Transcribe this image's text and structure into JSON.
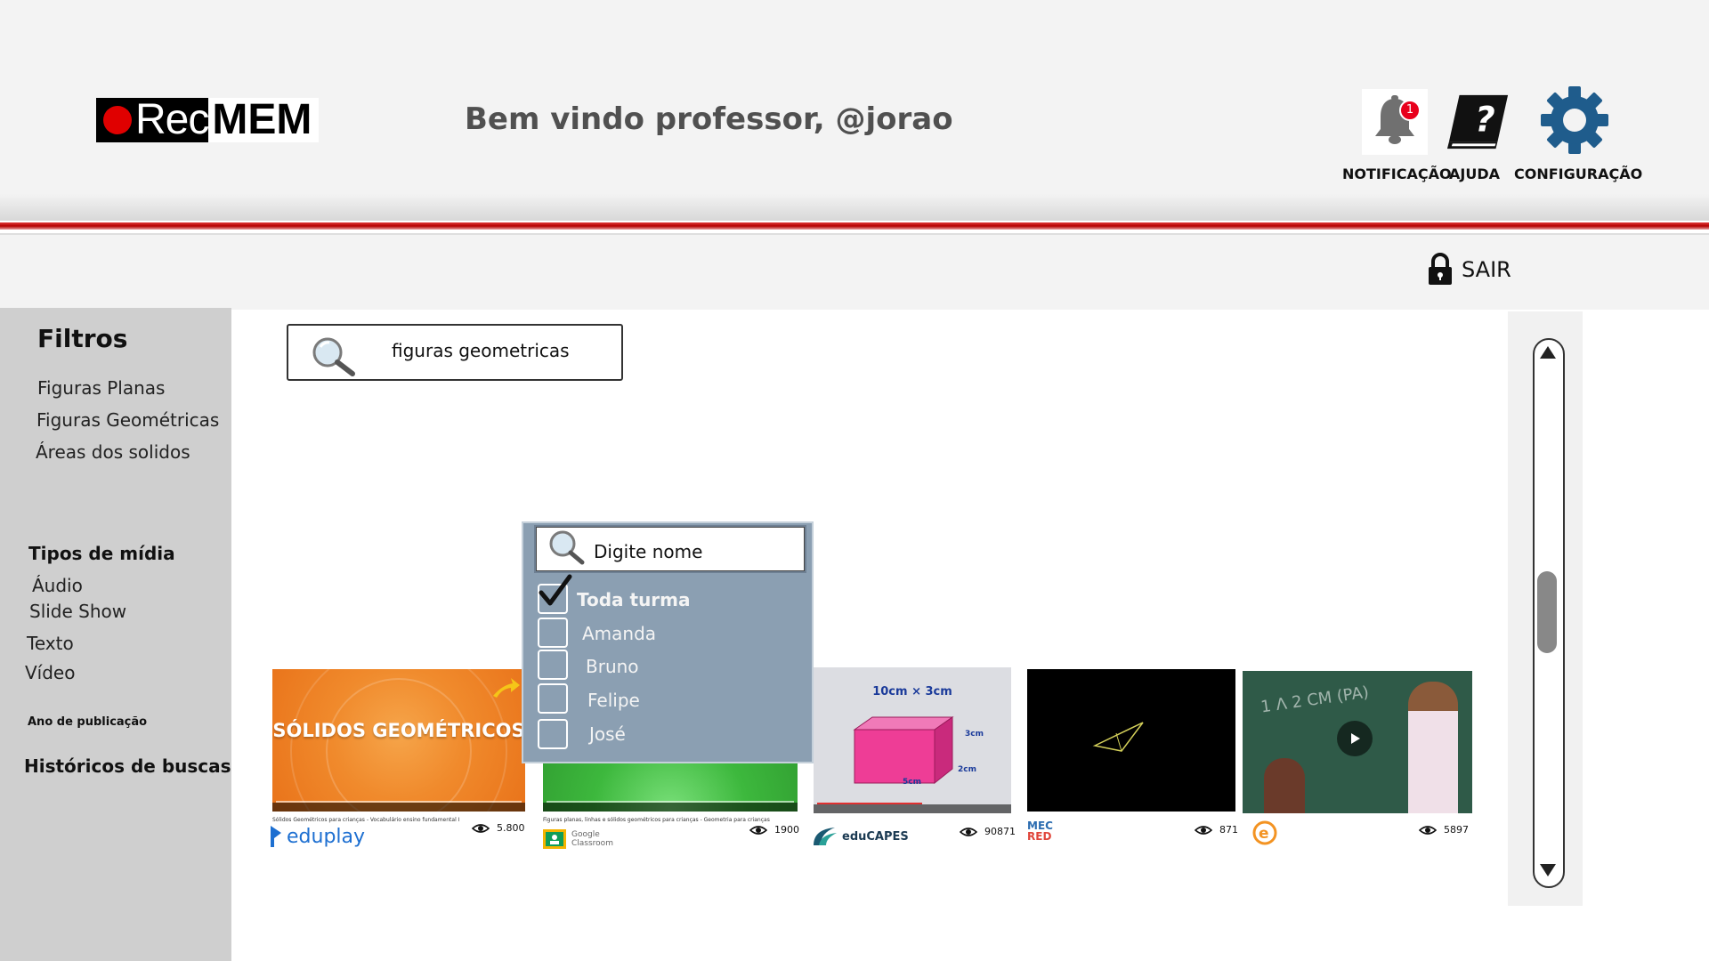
{
  "brand": {
    "logo_rec": "Rec",
    "logo_mem": "MEM",
    "accent": "#b30000"
  },
  "header": {
    "welcome": "Bem vindo professor, @jorao",
    "notification": {
      "label": "NOTIFICAÇÃO",
      "badge": "1",
      "icon": "bell-icon"
    },
    "help": {
      "label": "AJUDA",
      "icon": "help-book-icon"
    },
    "settings": {
      "label": "CONFIGURAÇÃO",
      "icon": "gear-icon"
    }
  },
  "logout": {
    "label": "SAIR",
    "icon": "lock-icon"
  },
  "sidebar": {
    "filters_title": "Filtros",
    "filters": [
      "Figuras Planas",
      "Figuras Geométricas",
      "Áreas dos solidos"
    ],
    "media_title": "Tipos de mídia",
    "media": [
      "Áudio",
      "Slide Show",
      "Texto",
      "Vídeo"
    ],
    "year_title": "Ano de publicação",
    "history_title": "Históricos de buscas"
  },
  "search": {
    "value": "figuras geometricas",
    "icon": "search-icon"
  },
  "student_picker": {
    "placeholder": "Digite nome",
    "items": [
      {
        "label": "Toda turma",
        "checked": true
      },
      {
        "label": "Amanda",
        "checked": false
      },
      {
        "label": "Bruno",
        "checked": false
      },
      {
        "label": "Felipe",
        "checked": false
      },
      {
        "label": "José",
        "checked": false
      }
    ]
  },
  "videos": [
    {
      "thumb_title": "SÓLIDOS GEOMÉTRICOS",
      "caption": "Sólidos Geométricos para crianças - Vocabulário ensino fundamental I",
      "source": "eduplay",
      "views": "5.800"
    },
    {
      "caption": "Figuras planas, linhas e sólidos geométricos para crianças - Geometria para crianças",
      "source_line1": "Google",
      "source_line2": "Classroom",
      "views": "1900"
    },
    {
      "thumb_label": "10cm × 3cm",
      "dims": [
        "3cm",
        "2cm",
        "5cm"
      ],
      "source": "eduCAPES",
      "views": "90871"
    },
    {
      "source_line1": "MEC",
      "source_line2": "RED",
      "views": "871"
    },
    {
      "thumb_text": "1 Λ 2 CM (PA)",
      "source": "e",
      "views": "5897"
    }
  ]
}
